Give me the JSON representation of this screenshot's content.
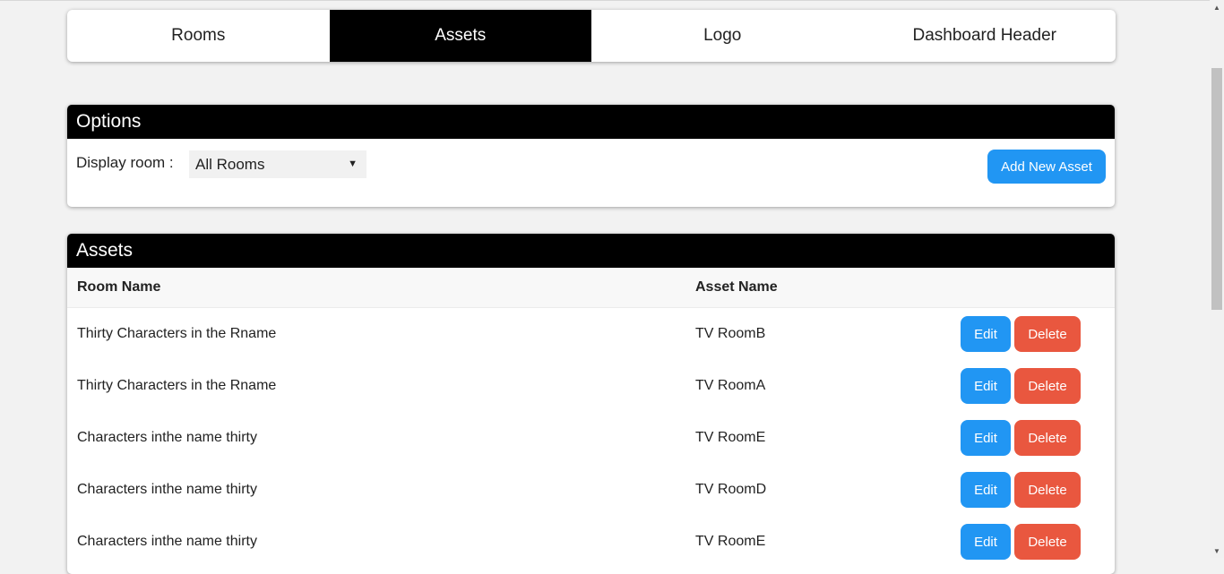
{
  "tabs": [
    {
      "label": "Rooms",
      "active": false
    },
    {
      "label": "Assets",
      "active": true
    },
    {
      "label": "Logo",
      "active": false
    },
    {
      "label": "Dashboard Header",
      "active": false
    }
  ],
  "options": {
    "title": "Options",
    "display_room_label": "Display room :",
    "selected_room": "All Rooms",
    "add_button_label": "Add New Asset"
  },
  "assets": {
    "title": "Assets",
    "columns": {
      "room_name": "Room Name",
      "asset_name": "Asset Name"
    },
    "edit_label": "Edit",
    "delete_label": "Delete",
    "rows": [
      {
        "room": "Thirty Characters in the Rname",
        "asset": "TV RoomB"
      },
      {
        "room": "Thirty Characters in the Rname",
        "asset": "TV RoomA"
      },
      {
        "room": "Characters inthe name thirty",
        "asset": "TV RoomE"
      },
      {
        "room": "Characters inthe name thirty",
        "asset": "TV RoomD"
      },
      {
        "room": "Characters inthe name thirty",
        "asset": "TV RoomE"
      }
    ]
  },
  "colors": {
    "accent_blue": "#2196f3",
    "danger_red": "#e9573f",
    "header_black": "#000000",
    "page_bg": "#f2f2f2"
  },
  "icons": {
    "select_arrow": "triangle-down-icon"
  }
}
